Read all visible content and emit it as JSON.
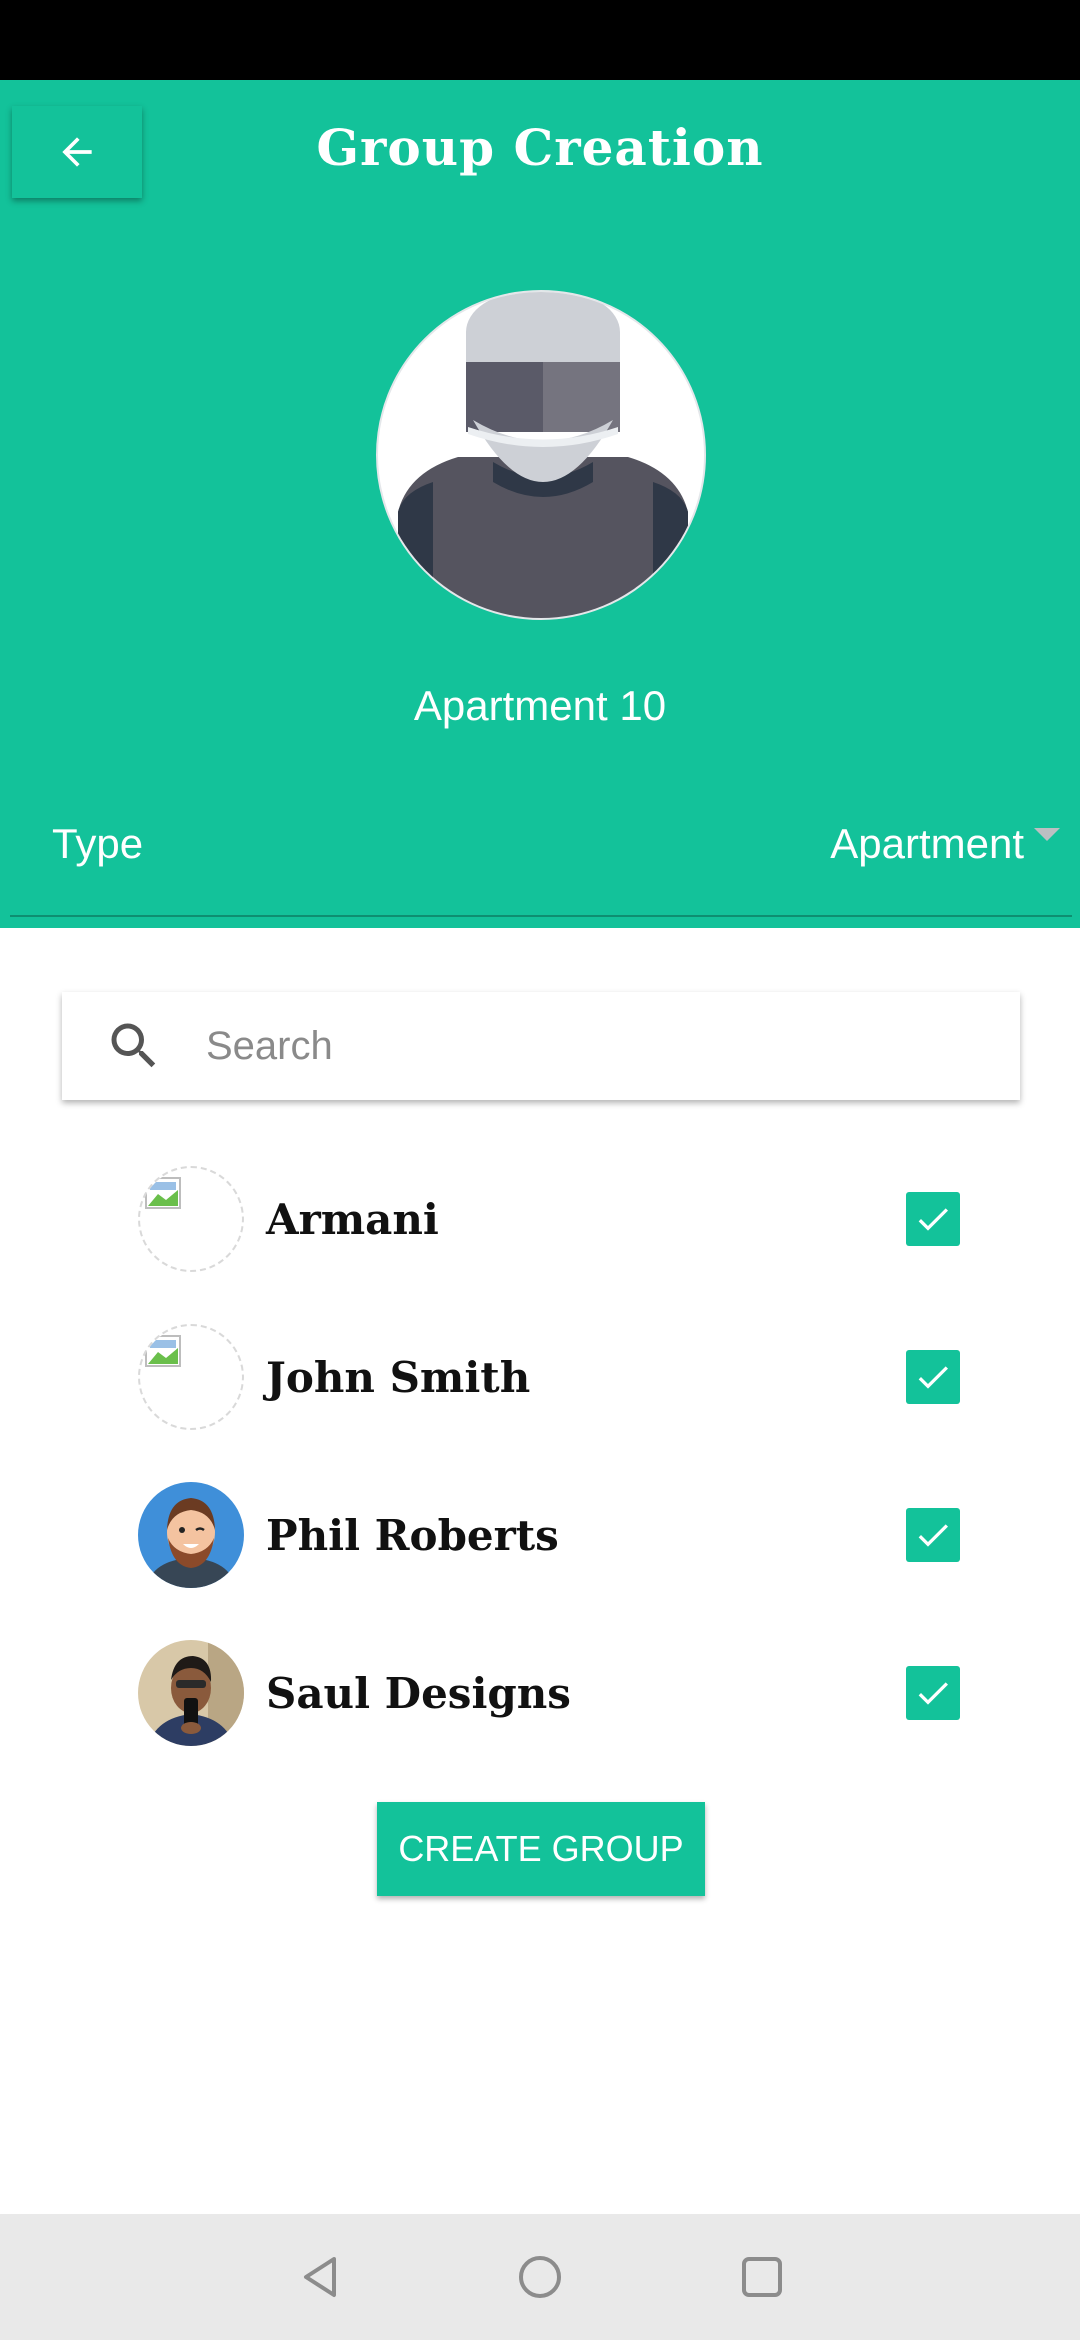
{
  "header": {
    "title": "Group Creation",
    "group_name": "Apartment 10",
    "type_label": "Type",
    "type_value": "Apartment",
    "color": "#13c29a"
  },
  "search": {
    "placeholder": "Search",
    "value": ""
  },
  "members": [
    {
      "name": "Armani",
      "checked": true,
      "avatar": "broken-image"
    },
    {
      "name": "John Smith",
      "checked": true,
      "avatar": "broken-image"
    },
    {
      "name": "Phil Roberts",
      "checked": true,
      "avatar": "cartoon-bearded-man"
    },
    {
      "name": "Saul Designs",
      "checked": true,
      "avatar": "photo-man-with-phone"
    }
  ],
  "actions": {
    "create_label": "CREATE GROUP"
  },
  "icons": {
    "back": "arrow-left-icon",
    "search": "search-icon",
    "check": "check-icon",
    "nav_back": "triangle-back-icon",
    "nav_home": "circle-home-icon",
    "nav_recents": "square-recents-icon"
  }
}
